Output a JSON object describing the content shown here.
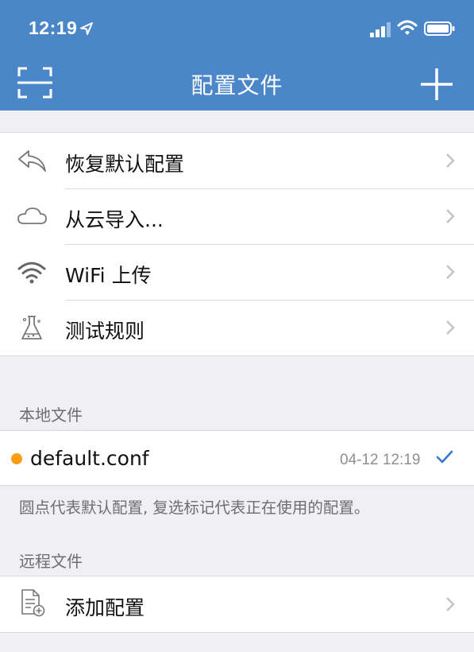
{
  "status_bar": {
    "time": "12:19"
  },
  "nav": {
    "title": "配置文件"
  },
  "actions": [
    {
      "label": "恢复默认配置",
      "icon": "reply-arrow-icon"
    },
    {
      "label": "从云导入...",
      "icon": "cloud-icon"
    },
    {
      "label": "WiFi 上传",
      "icon": "wifi-icon"
    },
    {
      "label": "测试规则",
      "icon": "flask-icon"
    }
  ],
  "local_section": {
    "label": "本地文件",
    "files": [
      {
        "name": "default.conf",
        "time": "04-12 12:19",
        "is_default": true,
        "in_use": true
      }
    ],
    "note": "圆点代表默认配置, 复选标记代表正在使用的配置。"
  },
  "remote_section": {
    "label": "远程文件",
    "add_label": "添加配置"
  },
  "colors": {
    "nav_bar": "#4a86c8",
    "default_dot": "#ff9d12",
    "check": "#3478c6",
    "background": "#efeff4"
  }
}
